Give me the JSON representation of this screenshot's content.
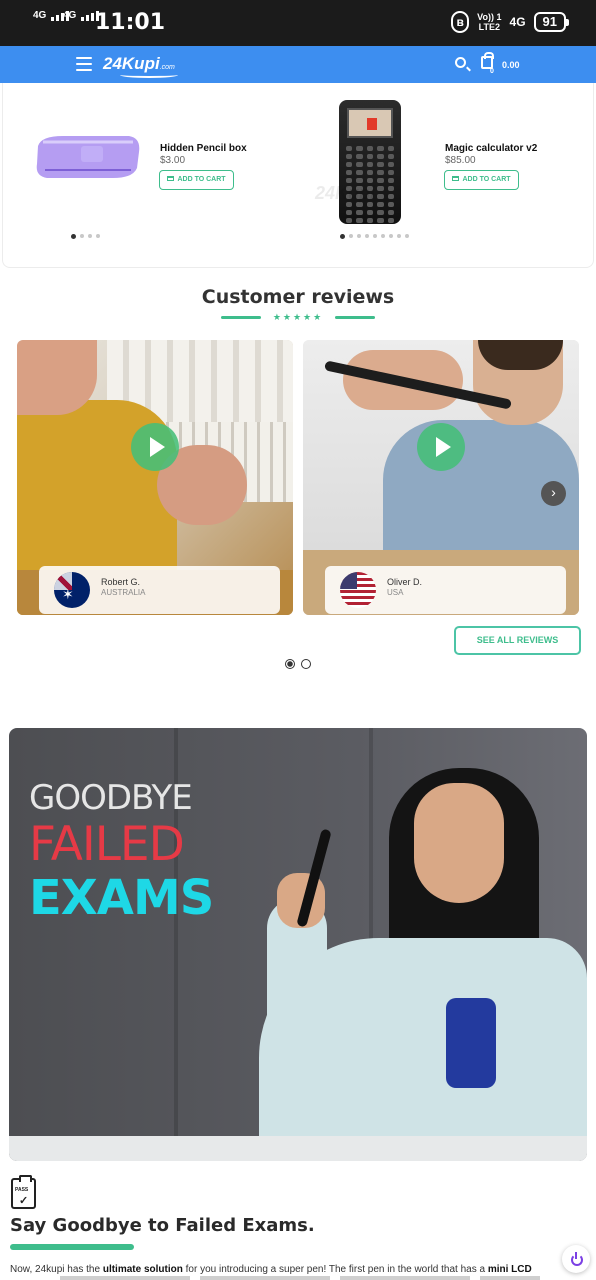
{
  "status_bar": {
    "net1": "4G",
    "net2": "4G",
    "time": "11:01",
    "volte": "Vo)) 1",
    "lte": "LTE2",
    "net3": "4G",
    "battery": "91"
  },
  "nav": {
    "logo": "24Kupi",
    "logo_suffix": ".com",
    "cart_count": "0",
    "cart_total": "0.00"
  },
  "products": [
    {
      "name": "Hidden Pencil box",
      "price": "$3.00",
      "button": "ADD TO CART"
    },
    {
      "name": "Magic calculator v2",
      "price": "$85.00",
      "button": "ADD TO CART"
    }
  ],
  "products_watermark": "24Kupi",
  "reviews": {
    "title": "Customer reviews",
    "stars": "★★★★★",
    "items": [
      {
        "name": "Robert G.",
        "country": "AUSTRALIA"
      },
      {
        "name": "Oliver D.",
        "country": "USA"
      }
    ],
    "next": "›",
    "see_all": "SEE ALL REVIEWS"
  },
  "banner": {
    "line1": "GOODBYE",
    "line2": "FAILED",
    "line3": "EXAMS"
  },
  "section": {
    "icon_label": "PASS",
    "title": "Say Goodbye to Failed Exams.",
    "body_1": "Now, 24kupi has the ",
    "body_bold": "ultimate solution",
    "body_2": " for you introducing a super pen! The first pen in the world that has a ",
    "body_bold2": "mini LCD"
  },
  "colors": {
    "nav_blue": "#3d8ef0",
    "accent_green": "#3ebd8c",
    "banner_red": "#e63a46",
    "banner_cyan": "#1ed8e6"
  }
}
